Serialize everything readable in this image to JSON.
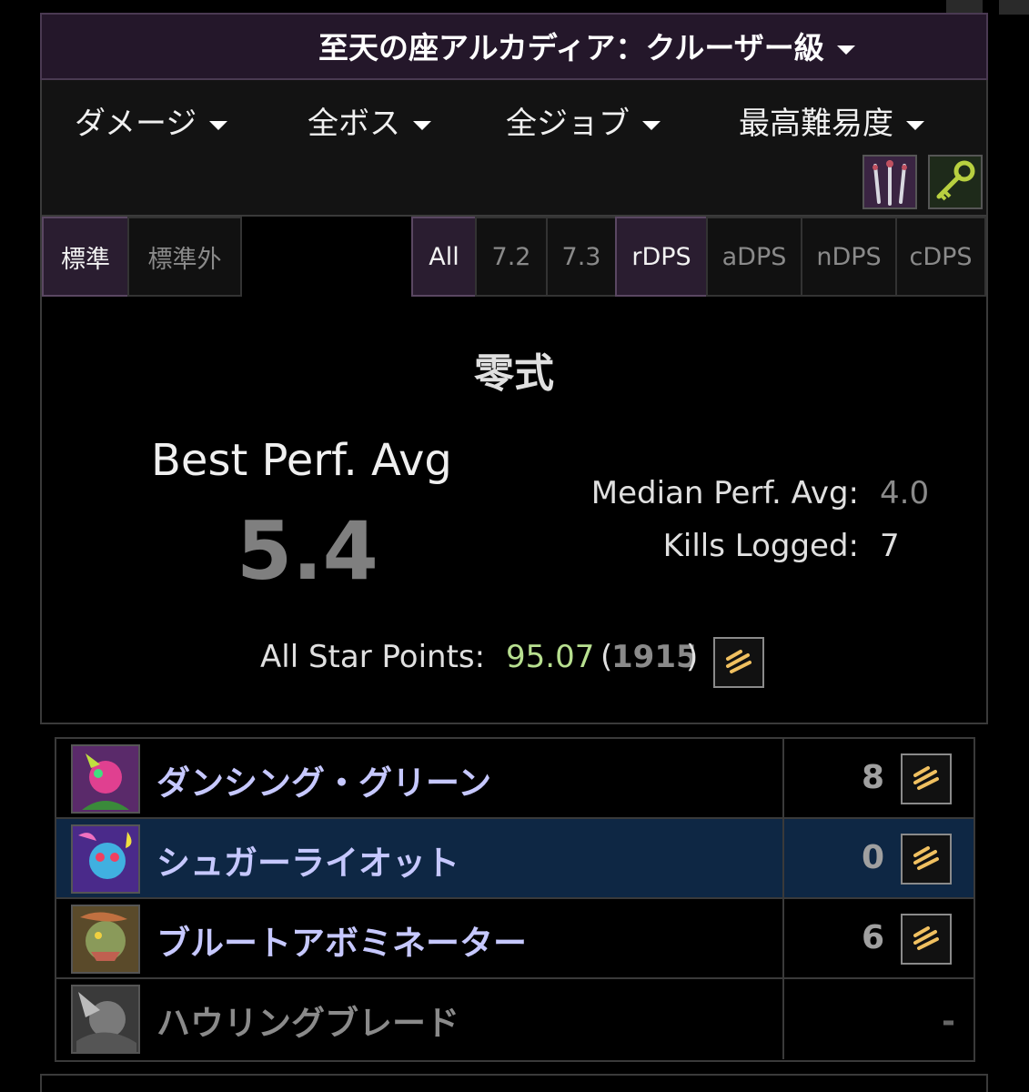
{
  "header": {
    "zone_title": "至天の座アルカディア：クルーザー級"
  },
  "filters": [
    {
      "label": "ダメージ"
    },
    {
      "label": "全ボス"
    },
    {
      "label": "全ジョブ"
    },
    {
      "label": "最高難易度"
    }
  ],
  "filter_icons": [
    "swords-icon",
    "key-icon"
  ],
  "tabs": {
    "standard": "標準",
    "nonstandard": "標準外",
    "all": "All",
    "v72": "7.2",
    "v73": "7.3",
    "rdps": "rDPS",
    "adps": "aDPS",
    "ndps": "nDPS",
    "cdps": "cDPS"
  },
  "summary": {
    "difficulty": "零式",
    "best_perf_label": "Best Perf. Avg",
    "best_perf_value": "5.4",
    "median_label": "Median Perf. Avg:",
    "median_value": "4.0",
    "kills_label": "Kills Logged:",
    "kills_value": "7",
    "all_star_label": "All Star Points:",
    "all_star_points": "95.07",
    "all_star_rank": "1915",
    "open_paren": "(",
    "close_paren": ")"
  },
  "bosses": [
    {
      "name": "ダンシング・グリーン",
      "score": "8",
      "selected": false
    },
    {
      "name": "シュガーライオット",
      "score": "0",
      "selected": true
    },
    {
      "name": "ブルートアボミネーター",
      "score": "6",
      "selected": false
    },
    {
      "name": "ハウリングブレード",
      "score": "-",
      "selected": false
    }
  ],
  "colors": {
    "accent_purple": "#2a1d30",
    "selected_row": "#0e2744",
    "boss_name": "#c6c8ff",
    "all_star_green": "#b8e090"
  }
}
